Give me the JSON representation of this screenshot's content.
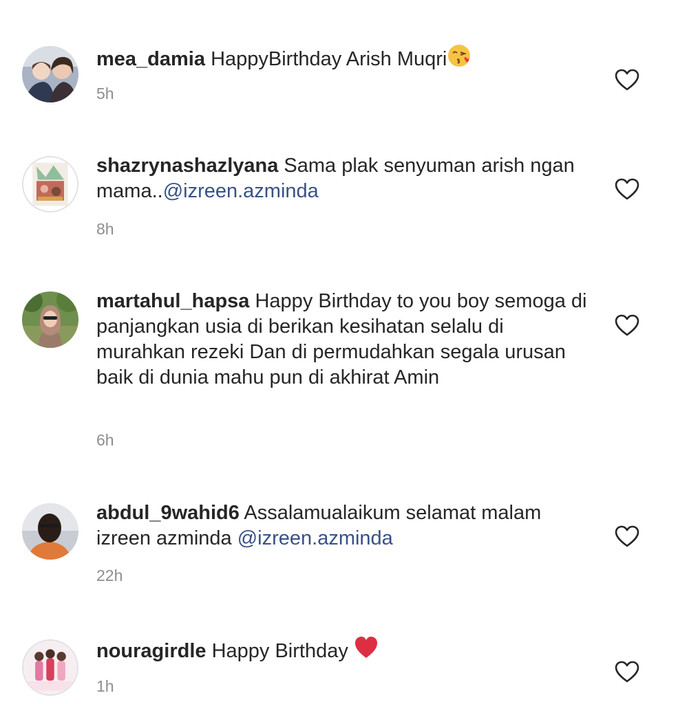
{
  "comments": [
    {
      "username": "mea_damia",
      "segments": [
        {
          "text": "HappyBirthday Arish Muqri",
          "type": "text"
        }
      ],
      "emoji": "kissing-heart-emoji",
      "time": "5h"
    },
    {
      "username": "shazrynashazlyana",
      "segments": [
        {
          "text": "Sama plak senyuman arish ngan mama..",
          "type": "text"
        },
        {
          "text": "@izreen.azminda",
          "type": "mention"
        }
      ],
      "time": "8h"
    },
    {
      "username": "martahul_hapsa",
      "segments": [
        {
          "text": "Happy Birthday to you boy semoga di panjangkan usia di berikan kesihatan selalu di murahkan rezeki Dan di permudahkan segala urusan baik di dunia mahu pun di akhirat Amin",
          "type": "text"
        }
      ],
      "time": "6h"
    },
    {
      "username": "abdul_9wahid6",
      "segments": [
        {
          "text": "Assalamualaikum selamat malam izreen azminda ",
          "type": "text"
        },
        {
          "text": "@izreen.azminda",
          "type": "mention"
        }
      ],
      "time": "22h"
    },
    {
      "username": "nouragirdle",
      "segments": [
        {
          "text": "Happy Birthday",
          "type": "text"
        }
      ],
      "emoji": "red-heart-emoji",
      "time": "1h"
    }
  ],
  "icons": {
    "like": "heart-outline-icon"
  },
  "colors": {
    "text": "#262626",
    "mention": "#385185",
    "meta": "#8e8e8e"
  }
}
